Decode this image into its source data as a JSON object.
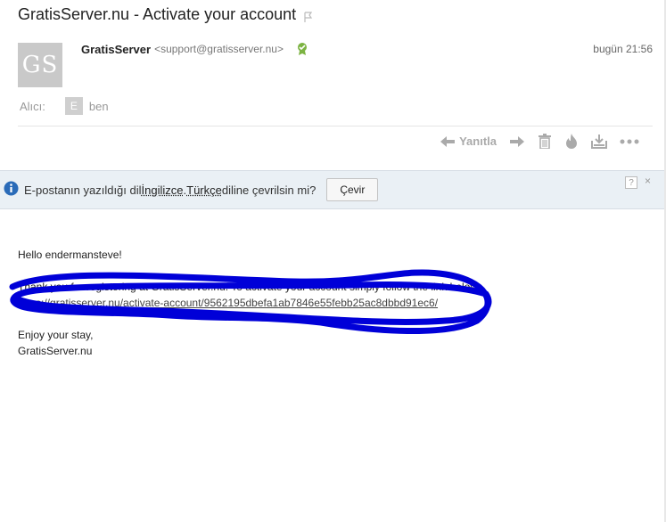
{
  "email": {
    "subject": "GratisServer.nu - Activate your account",
    "sender_name": "GratisServer",
    "sender_email": "<support@gratisserver.nu>",
    "avatar_initials": "GS",
    "date": "bugün 21:56",
    "to_label": "Alıcı:",
    "to_badge": "E",
    "to_name": "ben"
  },
  "toolbar": {
    "reply_label": "Yanıtla",
    "icons": [
      "reply-icon",
      "forward-icon",
      "delete-icon",
      "hot-icon",
      "download-icon",
      "more-icon"
    ]
  },
  "translate_bar": {
    "text_before": "E-postanın yazıldığı dil ",
    "source_lang": "İngilizce",
    "text_middle": ". ",
    "target_lang": "Türkçe",
    "text_after": " diline çevrilsin mi?",
    "button_label": "Çevir",
    "help_label": "?",
    "close_label": "×"
  },
  "body": {
    "greeting": "Hello endermansteve!",
    "instruction": "Thank you for registering at GratisServer.nu. To activate your account simply follow the link below:",
    "link": "https://gratisserver.nu/activate-account/9562195dbefa1ab7846e55febb25ac8dbbd91ec6/",
    "closing_1": "Enjoy your stay,",
    "closing_2": "GratisServer.nu"
  },
  "colors": {
    "scribble": "#0000d8",
    "translate_bar_bg": "#eaf0f5",
    "verified_badge": "#7cb342",
    "info_icon": "#2a6bb8"
  }
}
